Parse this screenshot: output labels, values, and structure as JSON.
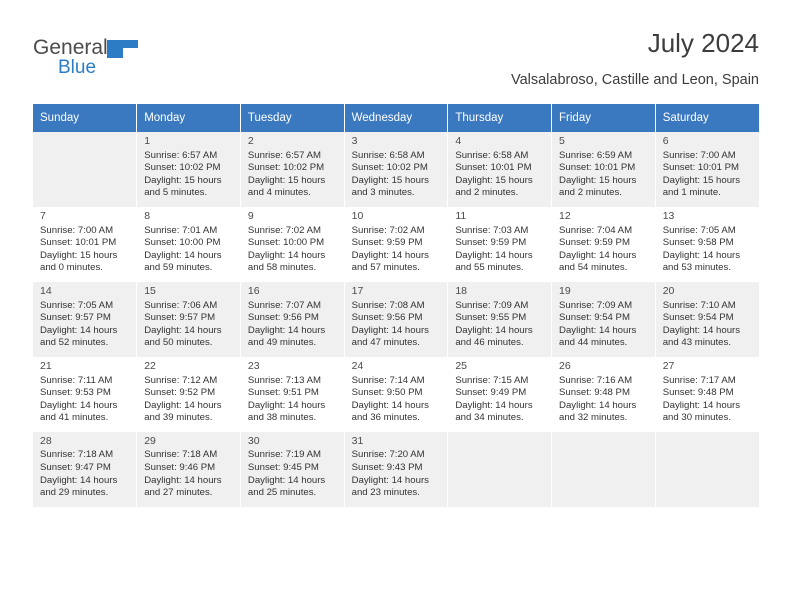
{
  "brand": {
    "general": "General",
    "blue": "Blue",
    "flag_icon": "flag-icon",
    "flag_color": "#2b7cc4"
  },
  "header": {
    "title": "July 2024",
    "subtitle": "Valsalabroso, Castille and Leon, Spain"
  },
  "theme": {
    "header_bg": "#3a78c0",
    "header_text": "#ffffff",
    "row_shade": "#f0f0f0",
    "row_plain": "#ffffff"
  },
  "weekdays": [
    "Sunday",
    "Monday",
    "Tuesday",
    "Wednesday",
    "Thursday",
    "Friday",
    "Saturday"
  ],
  "weeks": [
    [
      {
        "day": "",
        "lines": []
      },
      {
        "day": "1",
        "lines": [
          "Sunrise: 6:57 AM",
          "Sunset: 10:02 PM",
          "Daylight: 15 hours",
          "and 5 minutes."
        ]
      },
      {
        "day": "2",
        "lines": [
          "Sunrise: 6:57 AM",
          "Sunset: 10:02 PM",
          "Daylight: 15 hours",
          "and 4 minutes."
        ]
      },
      {
        "day": "3",
        "lines": [
          "Sunrise: 6:58 AM",
          "Sunset: 10:02 PM",
          "Daylight: 15 hours",
          "and 3 minutes."
        ]
      },
      {
        "day": "4",
        "lines": [
          "Sunrise: 6:58 AM",
          "Sunset: 10:01 PM",
          "Daylight: 15 hours",
          "and 2 minutes."
        ]
      },
      {
        "day": "5",
        "lines": [
          "Sunrise: 6:59 AM",
          "Sunset: 10:01 PM",
          "Daylight: 15 hours",
          "and 2 minutes."
        ]
      },
      {
        "day": "6",
        "lines": [
          "Sunrise: 7:00 AM",
          "Sunset: 10:01 PM",
          "Daylight: 15 hours",
          "and 1 minute."
        ]
      }
    ],
    [
      {
        "day": "7",
        "lines": [
          "Sunrise: 7:00 AM",
          "Sunset: 10:01 PM",
          "Daylight: 15 hours",
          "and 0 minutes."
        ]
      },
      {
        "day": "8",
        "lines": [
          "Sunrise: 7:01 AM",
          "Sunset: 10:00 PM",
          "Daylight: 14 hours",
          "and 59 minutes."
        ]
      },
      {
        "day": "9",
        "lines": [
          "Sunrise: 7:02 AM",
          "Sunset: 10:00 PM",
          "Daylight: 14 hours",
          "and 58 minutes."
        ]
      },
      {
        "day": "10",
        "lines": [
          "Sunrise: 7:02 AM",
          "Sunset: 9:59 PM",
          "Daylight: 14 hours",
          "and 57 minutes."
        ]
      },
      {
        "day": "11",
        "lines": [
          "Sunrise: 7:03 AM",
          "Sunset: 9:59 PM",
          "Daylight: 14 hours",
          "and 55 minutes."
        ]
      },
      {
        "day": "12",
        "lines": [
          "Sunrise: 7:04 AM",
          "Sunset: 9:59 PM",
          "Daylight: 14 hours",
          "and 54 minutes."
        ]
      },
      {
        "day": "13",
        "lines": [
          "Sunrise: 7:05 AM",
          "Sunset: 9:58 PM",
          "Daylight: 14 hours",
          "and 53 minutes."
        ]
      }
    ],
    [
      {
        "day": "14",
        "lines": [
          "Sunrise: 7:05 AM",
          "Sunset: 9:57 PM",
          "Daylight: 14 hours",
          "and 52 minutes."
        ]
      },
      {
        "day": "15",
        "lines": [
          "Sunrise: 7:06 AM",
          "Sunset: 9:57 PM",
          "Daylight: 14 hours",
          "and 50 minutes."
        ]
      },
      {
        "day": "16",
        "lines": [
          "Sunrise: 7:07 AM",
          "Sunset: 9:56 PM",
          "Daylight: 14 hours",
          "and 49 minutes."
        ]
      },
      {
        "day": "17",
        "lines": [
          "Sunrise: 7:08 AM",
          "Sunset: 9:56 PM",
          "Daylight: 14 hours",
          "and 47 minutes."
        ]
      },
      {
        "day": "18",
        "lines": [
          "Sunrise: 7:09 AM",
          "Sunset: 9:55 PM",
          "Daylight: 14 hours",
          "and 46 minutes."
        ]
      },
      {
        "day": "19",
        "lines": [
          "Sunrise: 7:09 AM",
          "Sunset: 9:54 PM",
          "Daylight: 14 hours",
          "and 44 minutes."
        ]
      },
      {
        "day": "20",
        "lines": [
          "Sunrise: 7:10 AM",
          "Sunset: 9:54 PM",
          "Daylight: 14 hours",
          "and 43 minutes."
        ]
      }
    ],
    [
      {
        "day": "21",
        "lines": [
          "Sunrise: 7:11 AM",
          "Sunset: 9:53 PM",
          "Daylight: 14 hours",
          "and 41 minutes."
        ]
      },
      {
        "day": "22",
        "lines": [
          "Sunrise: 7:12 AM",
          "Sunset: 9:52 PM",
          "Daylight: 14 hours",
          "and 39 minutes."
        ]
      },
      {
        "day": "23",
        "lines": [
          "Sunrise: 7:13 AM",
          "Sunset: 9:51 PM",
          "Daylight: 14 hours",
          "and 38 minutes."
        ]
      },
      {
        "day": "24",
        "lines": [
          "Sunrise: 7:14 AM",
          "Sunset: 9:50 PM",
          "Daylight: 14 hours",
          "and 36 minutes."
        ]
      },
      {
        "day": "25",
        "lines": [
          "Sunrise: 7:15 AM",
          "Sunset: 9:49 PM",
          "Daylight: 14 hours",
          "and 34 minutes."
        ]
      },
      {
        "day": "26",
        "lines": [
          "Sunrise: 7:16 AM",
          "Sunset: 9:48 PM",
          "Daylight: 14 hours",
          "and 32 minutes."
        ]
      },
      {
        "day": "27",
        "lines": [
          "Sunrise: 7:17 AM",
          "Sunset: 9:48 PM",
          "Daylight: 14 hours",
          "and 30 minutes."
        ]
      }
    ],
    [
      {
        "day": "28",
        "lines": [
          "Sunrise: 7:18 AM",
          "Sunset: 9:47 PM",
          "Daylight: 14 hours",
          "and 29 minutes."
        ]
      },
      {
        "day": "29",
        "lines": [
          "Sunrise: 7:18 AM",
          "Sunset: 9:46 PM",
          "Daylight: 14 hours",
          "and 27 minutes."
        ]
      },
      {
        "day": "30",
        "lines": [
          "Sunrise: 7:19 AM",
          "Sunset: 9:45 PM",
          "Daylight: 14 hours",
          "and 25 minutes."
        ]
      },
      {
        "day": "31",
        "lines": [
          "Sunrise: 7:20 AM",
          "Sunset: 9:43 PM",
          "Daylight: 14 hours",
          "and 23 minutes."
        ]
      },
      {
        "day": "",
        "lines": []
      },
      {
        "day": "",
        "lines": []
      },
      {
        "day": "",
        "lines": []
      }
    ]
  ]
}
